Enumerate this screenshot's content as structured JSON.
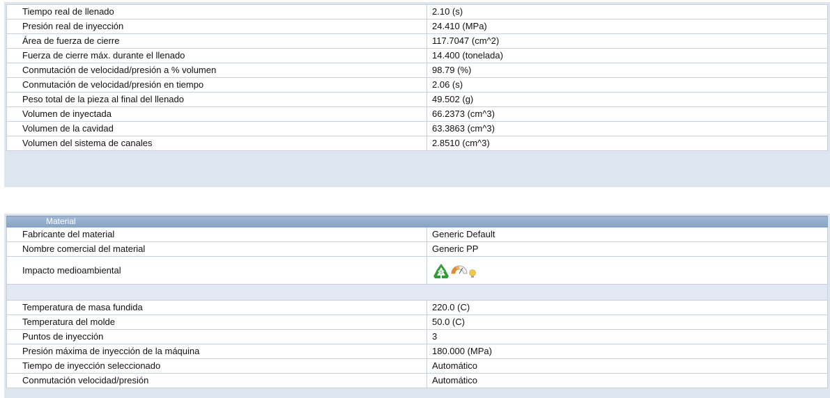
{
  "results": {
    "rows": [
      {
        "label": "Tiempo real de llenado",
        "value": "2.10 (s)"
      },
      {
        "label": "Presión real de inyección",
        "value": "24.410 (MPa)"
      },
      {
        "label": "Área de fuerza de cierre",
        "value": "117.7047 (cm^2)"
      },
      {
        "label": "Fuerza de cierre máx. durante el llenado",
        "value": "14.400 (tonelada)"
      },
      {
        "label": "Conmutación de velocidad/presión a % volumen",
        "value": "98.79 (%)"
      },
      {
        "label": "Conmutación de velocidad/presión en tiempo",
        "value": "2.06 (s)"
      },
      {
        "label": "Peso total de la pieza al final del llenado",
        "value": "49.502 (g)"
      },
      {
        "label": "Volumen de inyectada",
        "value": "66.2373 (cm^3)"
      },
      {
        "label": "Volumen de la cavidad",
        "value": "63.3863 (cm^3)"
      },
      {
        "label": "Volumen del sistema de canales",
        "value": "2.8510 (cm^3)"
      }
    ]
  },
  "material": {
    "header": "Material",
    "manufacturer_label": "Fabricante del material",
    "manufacturer_value": "Generic Default",
    "trade_name_label": "Nombre comercial del material",
    "trade_name_value": "Generic PP",
    "impact_label": "Impacto medioambiental",
    "recycle_code": "5",
    "icons": [
      "recycle-icon",
      "energy-gauge-icon",
      "light-bulb-icon"
    ],
    "colors": {
      "recycle": "#2e9e35",
      "gauge": "#e08a2a",
      "bulb": "#f5c842"
    }
  },
  "process": {
    "rows": [
      {
        "label": "Temperatura de masa fundida",
        "value": "220.0 (C)"
      },
      {
        "label": "Temperatura del molde",
        "value": "50.0 (C)"
      },
      {
        "label": "Puntos de inyección",
        "value": "3"
      },
      {
        "label": "Presión máxima de inyección de la máquina",
        "value": "180.000 (MPa)"
      },
      {
        "label": "Tiempo de inyección seleccionado",
        "value": "Automático"
      },
      {
        "label": "Conmutación velocidad/presión",
        "value": "Automático"
      }
    ]
  }
}
